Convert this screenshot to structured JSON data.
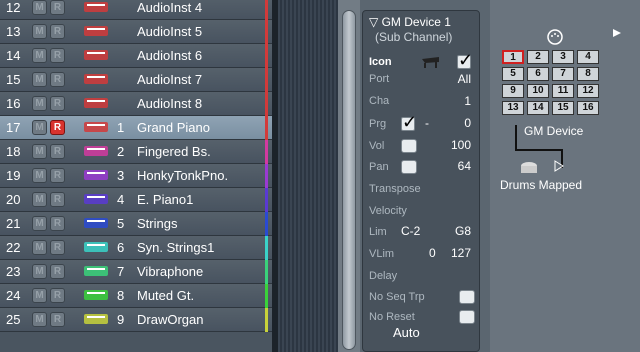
{
  "tracks": [
    {
      "num": "12",
      "idx": "",
      "name": "AudioInst  4",
      "icon": "audio-instrument-icon",
      "rec": false,
      "selected": false,
      "color": "#d23a3a"
    },
    {
      "num": "13",
      "idx": "",
      "name": "AudioInst  5",
      "icon": "audio-instrument-icon",
      "rec": false,
      "selected": false,
      "color": "#d23a3a"
    },
    {
      "num": "14",
      "idx": "",
      "name": "AudioInst  6",
      "icon": "audio-instrument-icon",
      "rec": false,
      "selected": false,
      "color": "#d23a3a"
    },
    {
      "num": "15",
      "idx": "",
      "name": "AudioInst  7",
      "icon": "audio-instrument-icon",
      "rec": false,
      "selected": false,
      "color": "#d23a3a"
    },
    {
      "num": "16",
      "idx": "",
      "name": "AudioInst  8",
      "icon": "audio-instrument-icon",
      "rec": false,
      "selected": false,
      "color": "#d23a3a"
    },
    {
      "num": "17",
      "idx": "1",
      "name": "Grand Piano",
      "icon": "grand-piano-icon",
      "rec": true,
      "selected": true,
      "color": "#d23a3a"
    },
    {
      "num": "18",
      "idx": "2",
      "name": "Fingered Bs.",
      "icon": "bass-guitar-icon",
      "rec": false,
      "selected": false,
      "color": "#d23aa0"
    },
    {
      "num": "19",
      "idx": "3",
      "name": "HonkyTonkPno.",
      "icon": "honkytonk-piano-icon",
      "rec": false,
      "selected": false,
      "color": "#9a3ad2"
    },
    {
      "num": "20",
      "idx": "4",
      "name": "E. Piano1",
      "icon": "electric-piano-icon",
      "rec": false,
      "selected": false,
      "color": "#5a3ad2"
    },
    {
      "num": "21",
      "idx": "5",
      "name": "Strings",
      "icon": "strings-icon",
      "rec": false,
      "selected": false,
      "color": "#2a4ad2"
    },
    {
      "num": "22",
      "idx": "6",
      "name": "Syn. Strings1",
      "icon": "synth-strings-icon",
      "rec": false,
      "selected": false,
      "color": "#3ad2c8"
    },
    {
      "num": "23",
      "idx": "7",
      "name": "Vibraphone",
      "icon": "vibraphone-icon",
      "rec": false,
      "selected": false,
      "color": "#3ad27a"
    },
    {
      "num": "24",
      "idx": "8",
      "name": "Muted Gt.",
      "icon": "muted-guitar-icon",
      "rec": false,
      "selected": false,
      "color": "#3ad23a"
    },
    {
      "num": "25",
      "idx": "9",
      "name": "DrawOrgan",
      "icon": "organ-icon",
      "rec": false,
      "selected": false,
      "color": "#c8d23a"
    }
  ],
  "mute_label": "M",
  "rec_label": "R",
  "inspector": {
    "title": "GM Device  1",
    "subtitle": "(Sub Channel)",
    "icon_label": "Icon",
    "port_label": "Port",
    "port_value": "All",
    "cha_label": "Cha",
    "cha_value": "1",
    "prg_label": "Prg",
    "prg_value": "0",
    "prg_dash": "-",
    "vol_label": "Vol",
    "vol_value": "100",
    "pan_label": "Pan",
    "pan_value": "64",
    "transpose_label": "Transpose",
    "velocity_label": "Velocity",
    "lim_label": "Lim",
    "lim_low": "C-2",
    "lim_high": "G8",
    "vlim_label": "VLim",
    "vlim_low": "0",
    "vlim_high": "127",
    "delay_label": "Delay",
    "noseq_label": "No Seq Trp",
    "noreset_label": "No Reset",
    "auto_label": "Auto"
  },
  "environment": {
    "gm_cells": [
      "1",
      "2",
      "3",
      "4",
      "5",
      "6",
      "7",
      "8",
      "9",
      "10",
      "11",
      "12",
      "13",
      "14",
      "15",
      "16"
    ],
    "gm_label": "GM Device",
    "drums_label": "Drums Mapped"
  }
}
